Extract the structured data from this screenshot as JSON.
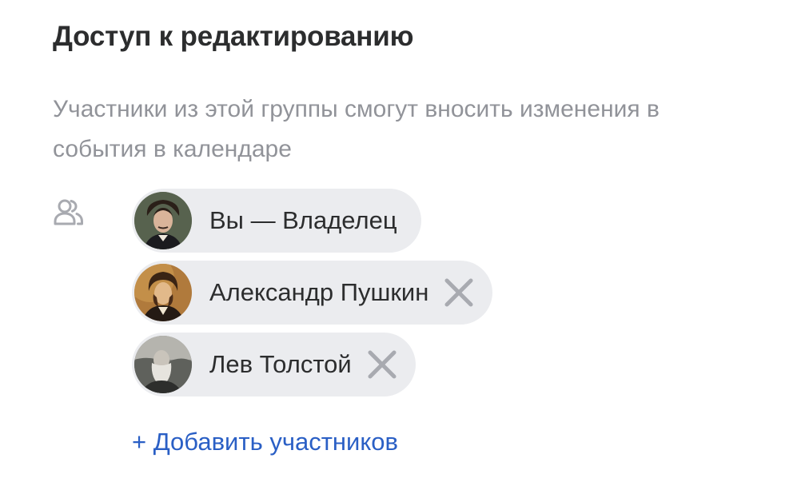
{
  "section": {
    "title": "Доступ к редактированию",
    "description": "Участники из этой группы смогут вносить изменения в события в календаре"
  },
  "icons": {
    "group": "people-icon",
    "remove": "close-icon"
  },
  "members": [
    {
      "name": "Вы — Владелец",
      "removable": false
    },
    {
      "name": "Александр Пушкин",
      "removable": true
    },
    {
      "name": "Лев Толстой",
      "removable": true
    }
  ],
  "add_link": "+ Добавить участников",
  "colors": {
    "chip_background": "#ebecef",
    "link": "#2a5fc5",
    "muted_text": "#919399",
    "remove_icon": "#a8aab0"
  }
}
